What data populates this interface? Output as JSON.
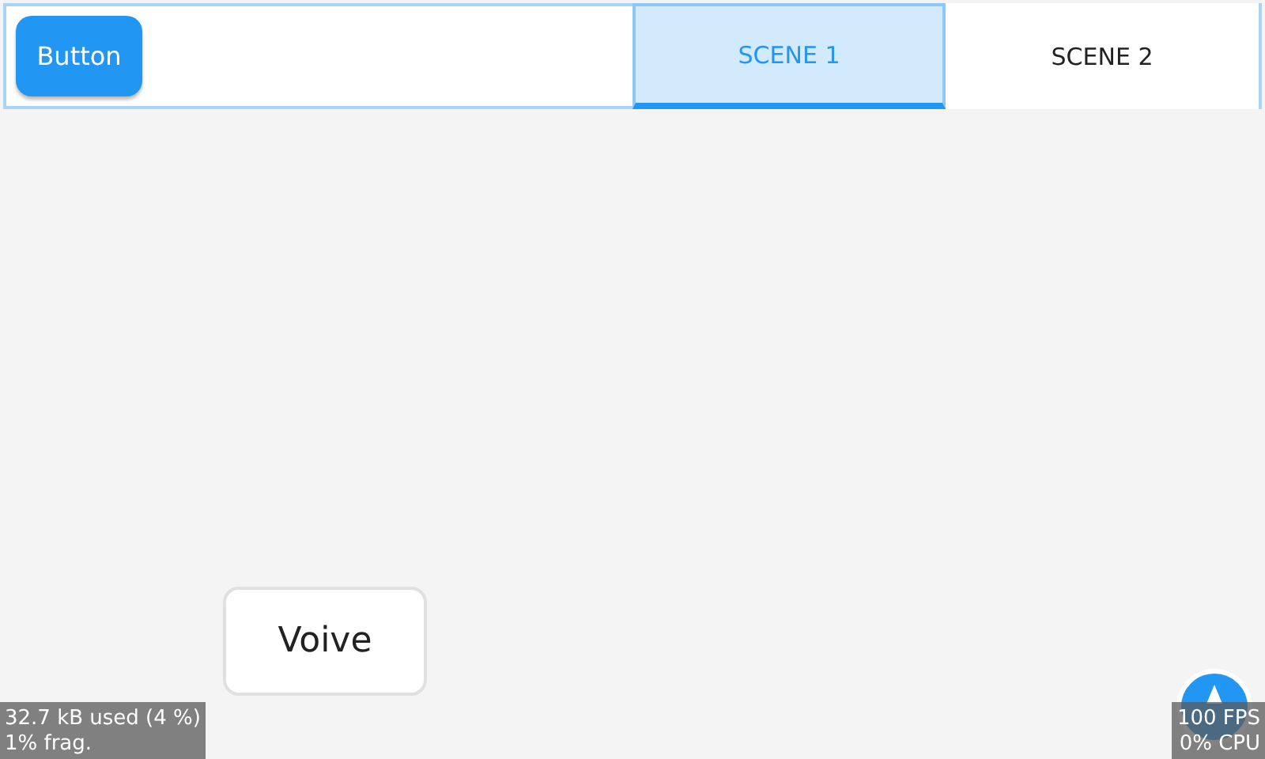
{
  "header": {
    "button": "Button",
    "tabs": [
      {
        "label": "SCENE 1",
        "selected": true
      },
      {
        "label": "SCENE 2",
        "selected": false
      }
    ]
  },
  "content": {
    "button": "Voive"
  },
  "memory_monitor": [
    "32.7 kB used (4 %)",
    "1% frag."
  ],
  "performance_monitor": [
    "100 FPS",
    "0% CPU"
  ]
}
